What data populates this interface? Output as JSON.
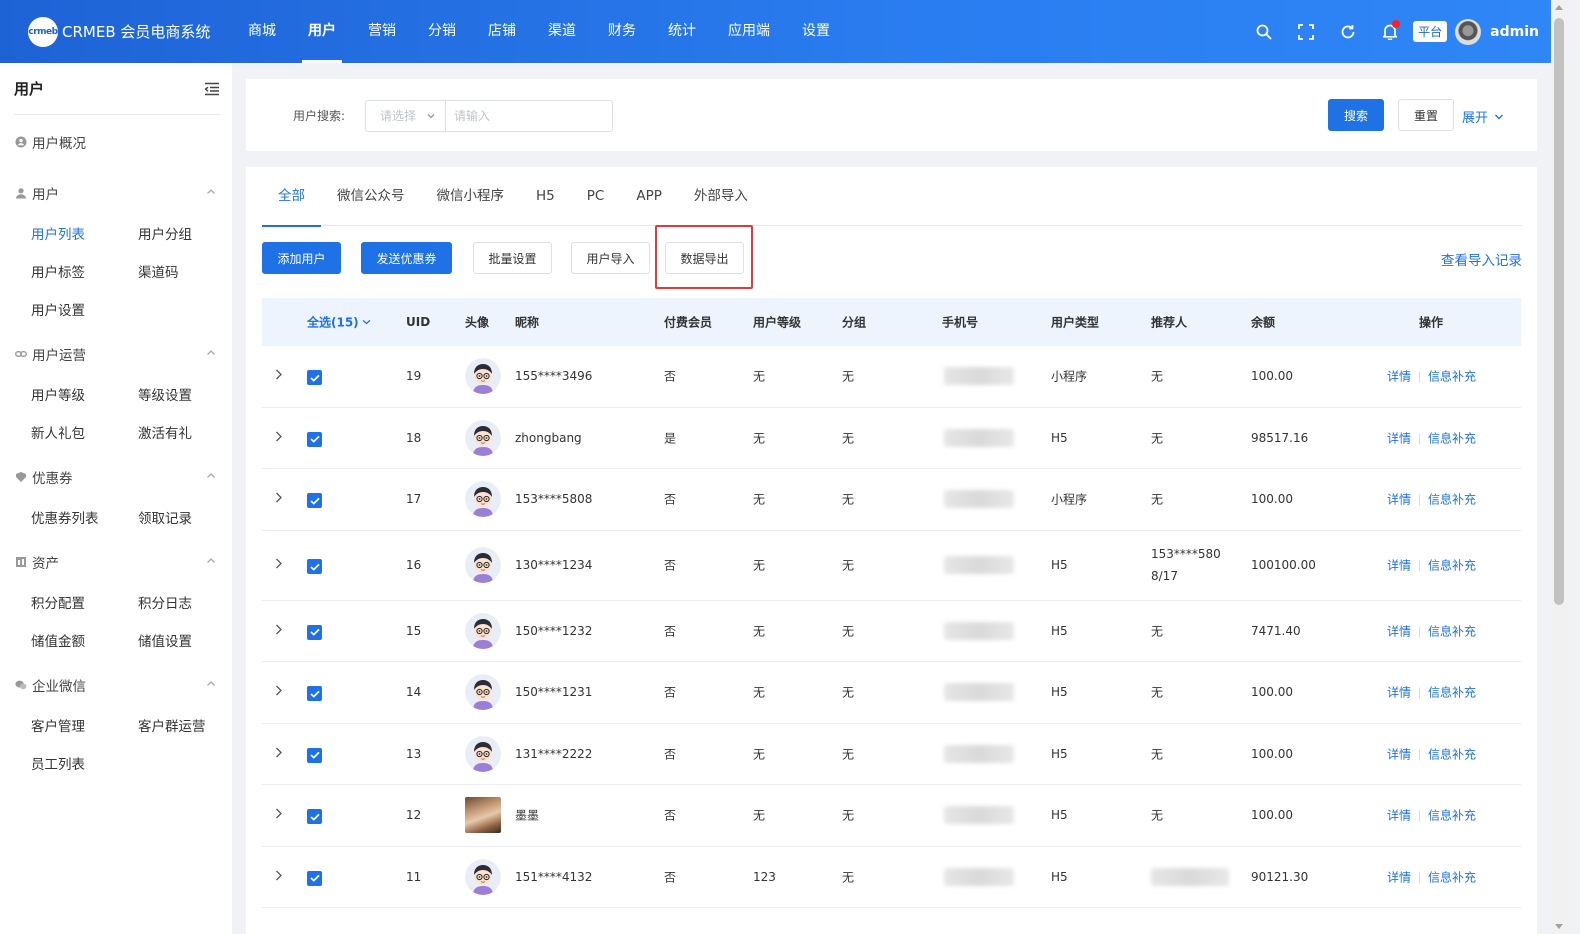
{
  "brand": {
    "logo_mark": "crmeb",
    "name": "CRMEB 会员电商系统"
  },
  "topnav": [
    {
      "label": "商城",
      "active": false
    },
    {
      "label": "用户",
      "active": true
    },
    {
      "label": "营销",
      "active": false
    },
    {
      "label": "分销",
      "active": false
    },
    {
      "label": "店铺",
      "active": false
    },
    {
      "label": "渠道",
      "active": false
    },
    {
      "label": "财务",
      "active": false
    },
    {
      "label": "统计",
      "active": false
    },
    {
      "label": "应用端",
      "active": false
    },
    {
      "label": "设置",
      "active": false
    }
  ],
  "topbar": {
    "platform": "平台",
    "admin": "admin",
    "icons": [
      "search-icon",
      "fullscreen-icon",
      "refresh-icon",
      "bell-icon"
    ]
  },
  "sidebar": {
    "title": "用户",
    "overview": "用户概况",
    "groups": [
      {
        "title": "用户",
        "icon": "user-icon",
        "items": [
          "用户列表",
          "用户分组",
          "用户标签",
          "渠道码",
          "用户设置"
        ],
        "active": "用户列表"
      },
      {
        "title": "用户运营",
        "icon": "link-icon",
        "items": [
          "用户等级",
          "等级设置",
          "新人礼包",
          "激活有礼"
        ]
      },
      {
        "title": "优惠券",
        "icon": "coupon-icon",
        "items": [
          "优惠券列表",
          "领取记录"
        ]
      },
      {
        "title": "资产",
        "icon": "asset-icon",
        "items": [
          "积分配置",
          "积分日志",
          "储值金额",
          "储值设置"
        ]
      },
      {
        "title": "企业微信",
        "icon": "wechat-work-icon",
        "items": [
          "客户管理",
          "客户群运营",
          "员工列表"
        ]
      }
    ]
  },
  "search": {
    "label": "用户搜索:",
    "select_placeholder": "请选择",
    "input_placeholder": "请输入",
    "search_btn": "搜索",
    "reset_btn": "重置",
    "expand": "展开"
  },
  "tabs": [
    "全部",
    "微信公众号",
    "微信小程序",
    "H5",
    "PC",
    "APP",
    "外部导入"
  ],
  "actions": {
    "add_user": "添加用户",
    "send_coupon": "发送优惠券",
    "batch_set": "批量设置",
    "import_user": "用户导入",
    "export_data": "数据导出",
    "view_import": "查看导入记录"
  },
  "table": {
    "headers": {
      "select_all": "全选(15)",
      "uid": "UID",
      "avatar": "头像",
      "nickname": "昵称",
      "paid": "付费会员",
      "level": "用户等级",
      "group": "分组",
      "phone": "手机号",
      "type": "用户类型",
      "referrer": "推荐人",
      "balance": "余额",
      "ops": "操作"
    },
    "op_detail": "详情",
    "op_supplement": "信息补充",
    "rows": [
      {
        "uid": "19",
        "nickname": "155****3496",
        "paid": "否",
        "level": "无",
        "group": "无",
        "type": "小程序",
        "referrer": "无",
        "balance": "100.00",
        "avatar": "cartoon"
      },
      {
        "uid": "18",
        "nickname": "zhongbang",
        "paid": "是",
        "level": "无",
        "group": "无",
        "type": "H5",
        "referrer": "无",
        "balance": "98517.16",
        "avatar": "cartoon"
      },
      {
        "uid": "17",
        "nickname": "153****5808",
        "paid": "否",
        "level": "无",
        "group": "无",
        "type": "小程序",
        "referrer": "无",
        "balance": "100.00",
        "avatar": "cartoon"
      },
      {
        "uid": "16",
        "nickname": "130****1234",
        "paid": "否",
        "level": "无",
        "group": "无",
        "type": "H5",
        "referrer": "153****5808/17",
        "balance": "100100.00",
        "avatar": "cartoon"
      },
      {
        "uid": "15",
        "nickname": "150****1232",
        "paid": "否",
        "level": "无",
        "group": "无",
        "type": "H5",
        "referrer": "无",
        "balance": "7471.40",
        "avatar": "cartoon"
      },
      {
        "uid": "14",
        "nickname": "150****1231",
        "paid": "否",
        "level": "无",
        "group": "无",
        "type": "H5",
        "referrer": "无",
        "balance": "100.00",
        "avatar": "cartoon"
      },
      {
        "uid": "13",
        "nickname": "131****2222",
        "paid": "否",
        "level": "无",
        "group": "无",
        "type": "H5",
        "referrer": "无",
        "balance": "100.00",
        "avatar": "cartoon"
      },
      {
        "uid": "12",
        "nickname": "墨墨",
        "paid": "否",
        "level": "无",
        "group": "无",
        "type": "H5",
        "referrer": "无",
        "balance": "100.00",
        "avatar": "photo"
      },
      {
        "uid": "11",
        "nickname": "151****4132",
        "paid": "否",
        "level": "123",
        "group": "无",
        "type": "H5",
        "referrer": "",
        "balance": "90121.30",
        "avatar": "cartoon"
      }
    ]
  },
  "colors": {
    "primary": "#1e72e6",
    "topbar": "#1e63d6",
    "highlight": "#e23a3a"
  }
}
